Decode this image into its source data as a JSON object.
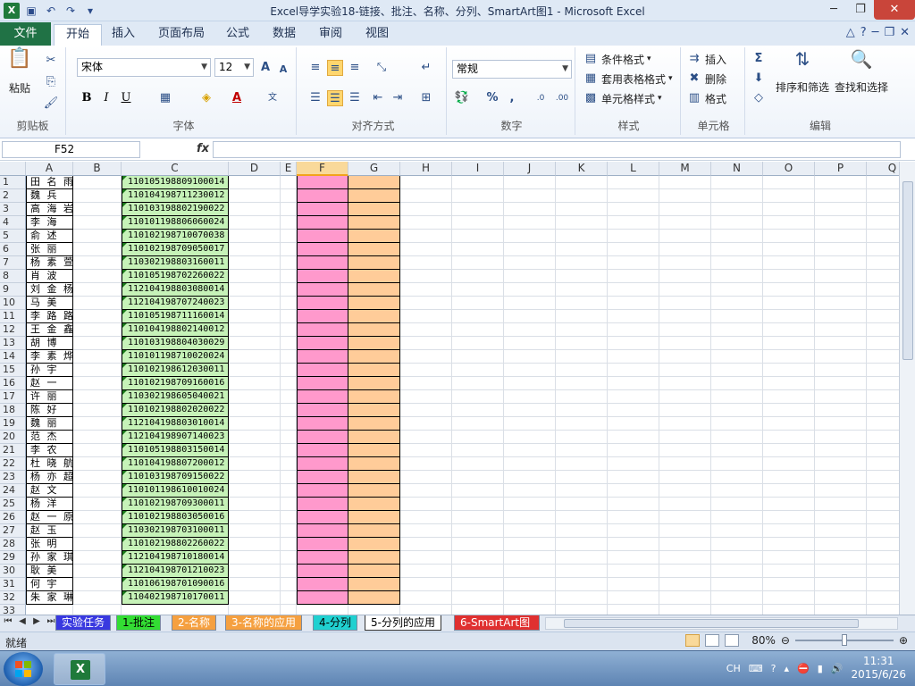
{
  "window": {
    "title": "Excel导学实验18-链接、批注、名称、分列、SmartArt图1 - Microsoft Excel"
  },
  "ribbon_tabs": [
    "文件",
    "开始",
    "插入",
    "页面布局",
    "公式",
    "数据",
    "审阅",
    "视图"
  ],
  "active_tab": "开始",
  "ribbon": {
    "clipboard": {
      "label": "剪贴板",
      "paste": "粘贴"
    },
    "font": {
      "label": "字体",
      "name": "宋体",
      "size": "12",
      "bold": "B",
      "italic": "I",
      "underline": "U"
    },
    "alignment": {
      "label": "对齐方式"
    },
    "number": {
      "label": "数字",
      "format": "常规"
    },
    "styles": {
      "label": "样式",
      "conditional": "条件格式",
      "table": "套用表格格式",
      "cell_style": "单元格样式"
    },
    "cells": {
      "label": "单元格",
      "insert": "插入",
      "delete": "删除",
      "format": "格式"
    },
    "editing": {
      "label": "编辑",
      "sort": "排序和筛选",
      "find": "查找和选择"
    }
  },
  "formula_bar": {
    "name_box": "F52",
    "fx": "fx",
    "formula": ""
  },
  "columns": [
    "A",
    "B",
    "C",
    "D",
    "E",
    "F",
    "G",
    "H",
    "I",
    "J",
    "K",
    "L",
    "M",
    "N",
    "O",
    "P",
    "Q"
  ],
  "selected_column": "F",
  "rows": [
    {
      "n": "1",
      "name": "田 名 雨",
      "id": "110105198809100014"
    },
    {
      "n": "2",
      "name": "魏    兵",
      "id": "110104198711230012"
    },
    {
      "n": "3",
      "name": "高 海 岩",
      "id": "110103198802190022"
    },
    {
      "n": "4",
      "name": "李    海",
      "id": "110101198806060024"
    },
    {
      "n": "5",
      "name": "俞    述",
      "id": "110102198710070038"
    },
    {
      "n": "6",
      "name": "张    丽",
      "id": "110102198709050017"
    },
    {
      "n": "7",
      "name": "杨 素 萱",
      "id": "110302198803160011"
    },
    {
      "n": "8",
      "name": "肖    波",
      "id": "110105198702260022"
    },
    {
      "n": "9",
      "name": "刘 金 杨",
      "id": "112104198803080014"
    },
    {
      "n": "10",
      "name": "马    美",
      "id": "112104198707240023"
    },
    {
      "n": "11",
      "name": "李 路 路",
      "id": "110105198711160014"
    },
    {
      "n": "12",
      "name": "王 金 鑫",
      "id": "110104198802140012"
    },
    {
      "n": "13",
      "name": "胡    博",
      "id": "110103198804030029"
    },
    {
      "n": "14",
      "name": "李 素 烨",
      "id": "110101198710020024"
    },
    {
      "n": "15",
      "name": "孙    宇",
      "id": "110102198612030011"
    },
    {
      "n": "16",
      "name": "赵    一",
      "id": "110102198709160016"
    },
    {
      "n": "17",
      "name": "许    丽",
      "id": "110302198605040021"
    },
    {
      "n": "18",
      "name": "陈    好",
      "id": "110102198802020022"
    },
    {
      "n": "19",
      "name": "魏    丽",
      "id": "112104198803010014"
    },
    {
      "n": "20",
      "name": "范    杰",
      "id": "112104198907140023"
    },
    {
      "n": "21",
      "name": "李    农",
      "id": "110105198803150014"
    },
    {
      "n": "22",
      "name": "杜 晓 航",
      "id": "110104198807200012"
    },
    {
      "n": "23",
      "name": "杨 亦 超",
      "id": "110103198709150022"
    },
    {
      "n": "24",
      "name": "赵    文",
      "id": "110101198610010024"
    },
    {
      "n": "25",
      "name": "杨    洋",
      "id": "110102198709300011"
    },
    {
      "n": "26",
      "name": "赵 一 原",
      "id": "110102198803050016"
    },
    {
      "n": "27",
      "name": "赵    玉",
      "id": "110302198703100011"
    },
    {
      "n": "28",
      "name": "张    明",
      "id": "110102198802260022"
    },
    {
      "n": "29",
      "name": "孙 家 琪",
      "id": "112104198710180014"
    },
    {
      "n": "30",
      "name": "耿    美",
      "id": "112104198701210023"
    },
    {
      "n": "31",
      "name": "何    宇",
      "id": "110106198701090016"
    },
    {
      "n": "32",
      "name": "朱 家 琳",
      "id": "110402198710170011"
    },
    {
      "n": "33",
      "name": "",
      "id": ""
    }
  ],
  "sheet_tabs": [
    "实验任务",
    "1-批注",
    "2-名称",
    "3-名称的应用",
    "4-分列",
    "5-分列的应用",
    "6-SmartArt图"
  ],
  "active_sheet": "5-分列的应用",
  "status": {
    "ready": "就绪",
    "zoom": "80%"
  },
  "taskbar": {
    "lang": "CH",
    "time": "11:31",
    "date": "2015/6/26"
  },
  "colors": {
    "pink": "#ff99cc",
    "orange": "#ffcc99",
    "id_green": "#c6f2b8",
    "file_tab": "#207245"
  }
}
